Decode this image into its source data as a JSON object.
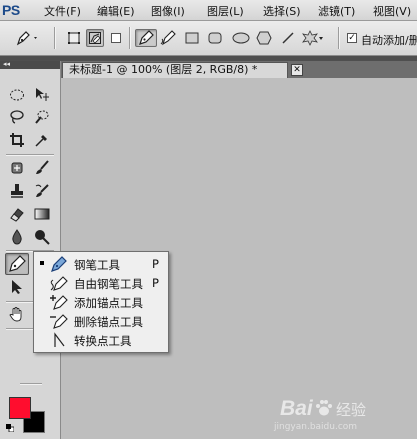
{
  "app": {
    "logo": "PS"
  },
  "menu": [
    {
      "label": "文件(F)"
    },
    {
      "label": "编辑(E)"
    },
    {
      "label": "图像(I)"
    },
    {
      "label": "图层(L)"
    },
    {
      "label": "选择(S)"
    },
    {
      "label": "滤镜(T)"
    },
    {
      "label": "视图(V)"
    }
  ],
  "options_bar": {
    "auto_add_label": "自动添加/删",
    "auto_add_checked": true
  },
  "panel": {
    "collapse_glyph": "◂◂"
  },
  "document": {
    "tab_title": "未标题-1 @ 100% (图层 2, RGB/8) *",
    "close_glyph": "✕"
  },
  "colors": {
    "foreground": "#ff0d2e",
    "background": "#000000"
  },
  "flyout": {
    "items": [
      {
        "label": "钢笔工具",
        "shortcut": "P",
        "selected": true,
        "icon": "pen-icon"
      },
      {
        "label": "自由钢笔工具",
        "shortcut": "P",
        "selected": false,
        "icon": "freeform-pen-icon"
      },
      {
        "label": "添加锚点工具",
        "shortcut": "",
        "selected": false,
        "icon": "add-anchor-icon"
      },
      {
        "label": "删除锚点工具",
        "shortcut": "",
        "selected": false,
        "icon": "delete-anchor-icon"
      },
      {
        "label": "转换点工具",
        "shortcut": "",
        "selected": false,
        "icon": "convert-point-icon"
      }
    ]
  },
  "watermark": {
    "brand_latin": "Bai",
    "brand_cn": "经验",
    "url": "jingyan.baidu.com"
  }
}
